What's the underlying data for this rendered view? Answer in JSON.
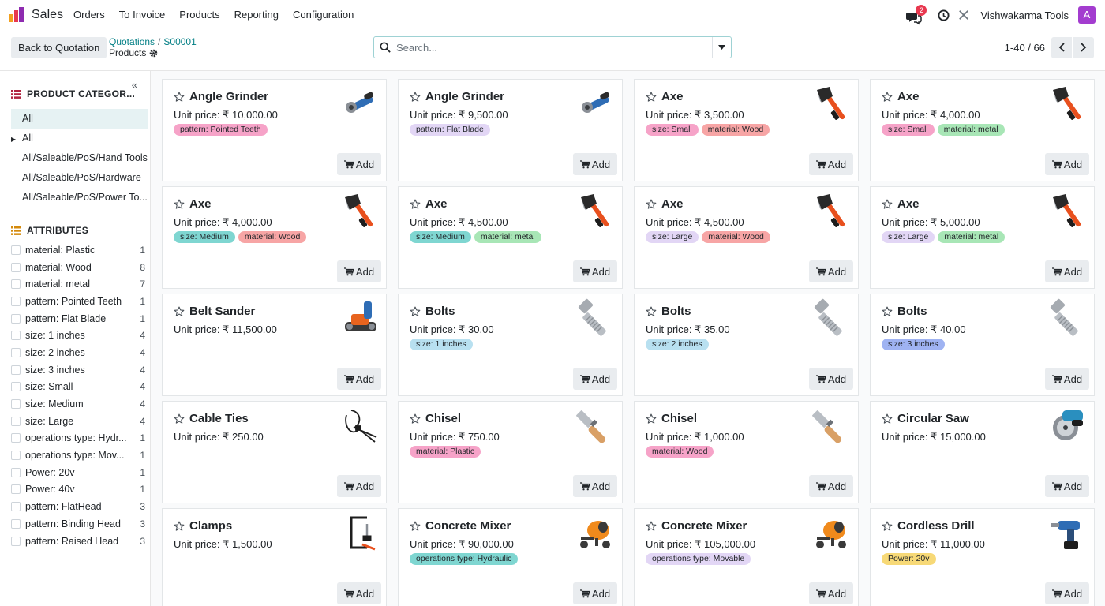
{
  "app": {
    "name": "Sales"
  },
  "menu": [
    "Orders",
    "To Invoice",
    "Products",
    "Reporting",
    "Configuration"
  ],
  "navbar": {
    "message_count": "2",
    "company": "Vishwakarma Tools",
    "avatar_letter": "A"
  },
  "control": {
    "back_label": "Back to Quotation",
    "breadcrumb": {
      "level1": "Quotations",
      "level2": "S00001",
      "current": "Products"
    },
    "search_placeholder": "Search...",
    "pager": "1-40 / 66"
  },
  "sidebar": {
    "categories_title": "PRODUCT CATEGOR...",
    "categories": [
      "All",
      "All",
      "All/Saleable/PoS/Hand Tools",
      "All/Saleable/PoS/Hardware",
      "All/Saleable/PoS/Power To..."
    ],
    "attributes_title": "ATTRIBUTES",
    "attributes": [
      {
        "label": "material: Plastic",
        "count": "1"
      },
      {
        "label": "material: Wood",
        "count": "8"
      },
      {
        "label": "material: metal",
        "count": "7"
      },
      {
        "label": "pattern: Pointed Teeth",
        "count": "1"
      },
      {
        "label": "pattern: Flat Blade",
        "count": "1"
      },
      {
        "label": "size: 1 inches",
        "count": "4"
      },
      {
        "label": "size: 2 inches",
        "count": "4"
      },
      {
        "label": "size: 3 inches",
        "count": "4"
      },
      {
        "label": "size: Small",
        "count": "4"
      },
      {
        "label": "size: Medium",
        "count": "4"
      },
      {
        "label": "size: Large",
        "count": "4"
      },
      {
        "label": "operations type: Hydr...",
        "count": "1"
      },
      {
        "label": "operations type: Mov...",
        "count": "1"
      },
      {
        "label": "Power: 20v",
        "count": "1"
      },
      {
        "label": "Power: 40v",
        "count": "1"
      },
      {
        "label": "pattern: FlatHead",
        "count": "3"
      },
      {
        "label": "pattern: Binding Head",
        "count": "3"
      },
      {
        "label": "pattern: Raised Head",
        "count": "3"
      }
    ]
  },
  "add_label": "Add",
  "products": [
    {
      "name": "Angle Grinder",
      "price": "Unit price: ₹ 10,000.00",
      "icon": "angle-grinder",
      "tags": [
        {
          "text": "pattern: Pointed Teeth",
          "color": "#f6a3c8"
        }
      ]
    },
    {
      "name": "Angle Grinder",
      "price": "Unit price: ₹ 9,500.00",
      "icon": "angle-grinder",
      "tags": [
        {
          "text": "pattern: Flat Blade",
          "color": "#e2d6f5"
        }
      ]
    },
    {
      "name": "Axe",
      "price": "Unit price: ₹ 3,500.00",
      "icon": "axe",
      "tags": [
        {
          "text": "size: Small",
          "color": "#f6a3c8"
        },
        {
          "text": "material: Wood",
          "color": "#f7a5a5"
        }
      ]
    },
    {
      "name": "Axe",
      "price": "Unit price: ₹ 4,000.00",
      "icon": "axe",
      "tags": [
        {
          "text": "size: Small",
          "color": "#f6a3c8"
        },
        {
          "text": "material: metal",
          "color": "#a8e6b6"
        }
      ]
    },
    {
      "name": "Axe",
      "price": "Unit price: ₹ 4,000.00",
      "icon": "axe",
      "tags": [
        {
          "text": "size: Medium",
          "color": "#7fd6d1"
        },
        {
          "text": "material: Wood",
          "color": "#f7a5a5"
        }
      ]
    },
    {
      "name": "Axe",
      "price": "Unit price: ₹ 4,500.00",
      "icon": "axe",
      "tags": [
        {
          "text": "size: Medium",
          "color": "#7fd6d1"
        },
        {
          "text": "material: metal",
          "color": "#a8e6b6"
        }
      ]
    },
    {
      "name": "Axe",
      "price": "Unit price: ₹ 4,500.00",
      "icon": "axe",
      "tags": [
        {
          "text": "size: Large",
          "color": "#e2d6f5"
        },
        {
          "text": "material: Wood",
          "color": "#f7a5a5"
        }
      ]
    },
    {
      "name": "Axe",
      "price": "Unit price: ₹ 5,000.00",
      "icon": "axe",
      "tags": [
        {
          "text": "size: Large",
          "color": "#e2d6f5"
        },
        {
          "text": "material: metal",
          "color": "#a8e6b6"
        }
      ]
    },
    {
      "name": "Belt Sander",
      "price": "Unit price: ₹ 11,500.00",
      "icon": "belt-sander",
      "tags": []
    },
    {
      "name": "Bolts",
      "price": "Unit price: ₹ 30.00",
      "icon": "bolt",
      "tags": [
        {
          "text": "size: 1 inches",
          "color": "#b8e0f0"
        }
      ]
    },
    {
      "name": "Bolts",
      "price": "Unit price: ₹ 35.00",
      "icon": "bolt",
      "tags": [
        {
          "text": "size: 2 inches",
          "color": "#b8e0f0"
        }
      ]
    },
    {
      "name": "Bolts",
      "price": "Unit price: ₹ 40.00",
      "icon": "bolt",
      "tags": [
        {
          "text": "size: 3 inches",
          "color": "#9fb3f2"
        }
      ]
    },
    {
      "name": "Cable Ties",
      "price": "Unit price: ₹ 250.00",
      "icon": "cable-ties",
      "tags": []
    },
    {
      "name": "Chisel",
      "price": "Unit price: ₹ 750.00",
      "icon": "chisel",
      "tags": [
        {
          "text": "material: Plastic",
          "color": "#f6a3c8"
        }
      ]
    },
    {
      "name": "Chisel",
      "price": "Unit price: ₹ 1,000.00",
      "icon": "chisel",
      "tags": [
        {
          "text": "material: Wood",
          "color": "#f6a3c8"
        }
      ]
    },
    {
      "name": "Circular Saw",
      "price": "Unit price: ₹ 15,000.00",
      "icon": "circular-saw",
      "tags": []
    },
    {
      "name": "Clamps",
      "price": "Unit price: ₹ 1,500.00",
      "icon": "clamp",
      "tags": []
    },
    {
      "name": "Concrete Mixer",
      "price": "Unit price: ₹ 90,000.00",
      "icon": "concrete-mixer",
      "tags": [
        {
          "text": "operations type: Hydraulic",
          "color": "#7fd6d1"
        }
      ]
    },
    {
      "name": "Concrete Mixer",
      "price": "Unit price: ₹ 105,000.00",
      "icon": "concrete-mixer",
      "tags": [
        {
          "text": "operations type: Movable",
          "color": "#e2d6f5"
        }
      ]
    },
    {
      "name": "Cordless Drill",
      "price": "Unit price: ₹ 11,000.00",
      "icon": "cordless-drill",
      "tags": [
        {
          "text": "Power: 20v",
          "color": "#f7d977"
        }
      ]
    }
  ]
}
